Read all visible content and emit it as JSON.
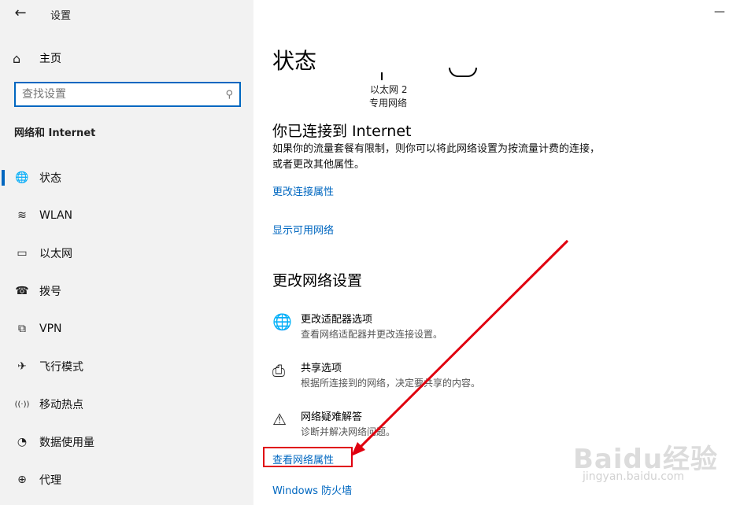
{
  "window": {
    "title": "设置",
    "back_icon": "←",
    "minimize_icon": "—"
  },
  "sidebar": {
    "home": {
      "icon": "⌂",
      "label": "主页"
    },
    "search": {
      "placeholder": "查找设置",
      "icon": "⚲"
    },
    "section_label": "网络和 Internet",
    "items": [
      {
        "icon": "🌐",
        "label": "状态",
        "active": true
      },
      {
        "icon": "≋",
        "label": "WLAN"
      },
      {
        "icon": "▭",
        "label": "以太网"
      },
      {
        "icon": "☎",
        "label": "拨号"
      },
      {
        "icon": "⧉",
        "label": "VPN"
      },
      {
        "icon": "✈",
        "label": "飞行模式"
      },
      {
        "icon": "((·))",
        "label": "移动热点"
      },
      {
        "icon": "◔",
        "label": "数据使用量"
      },
      {
        "icon": "⊕",
        "label": "代理"
      }
    ]
  },
  "main": {
    "title": "状态",
    "network": {
      "name": "以太网 2",
      "type": "专用网络"
    },
    "connected_title": "你已连接到 Internet",
    "connected_desc": "如果你的流量套餐有限制，则你可以将此网络设置为按流量计费的连接，或者更改其他属性。",
    "link_change_props": "更改连接属性",
    "link_show_networks": "显示可用网络",
    "change_title": "更改网络设置",
    "options": [
      {
        "icon": "🌐",
        "title": "更改适配器选项",
        "desc": "查看网络适配器并更改连接设置。"
      },
      {
        "icon": "⎙",
        "title": "共享选项",
        "desc": "根据所连接到的网络，决定要共享的内容。"
      },
      {
        "icon": "⚠",
        "title": "网络疑难解答",
        "desc": "诊断并解决网络问题。"
      }
    ],
    "link_view_props": "查看网络属性",
    "link_firewall": "Windows 防火墙"
  },
  "annotation": {
    "color": "#e0000f"
  },
  "watermark": {
    "brand": "Baidu经验",
    "sub": "jingyan.baidu.com"
  },
  "colors": {
    "accent": "#0067c0",
    "sidebar_bg": "#f2f2f2"
  }
}
